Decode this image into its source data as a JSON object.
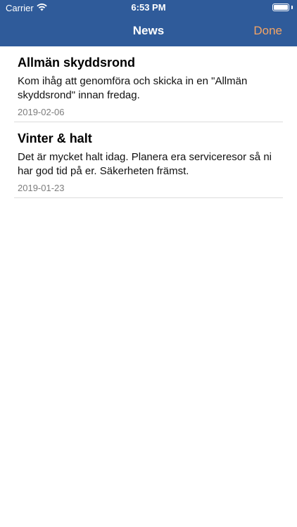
{
  "status_bar": {
    "carrier": "Carrier",
    "time": "6:53 PM",
    "wifi_icon": "wifi-icon",
    "battery_icon": "battery-icon"
  },
  "nav": {
    "title": "News",
    "done_label": "Done",
    "done_color": "#f3a465",
    "bar_color": "#2f5b9a"
  },
  "news": [
    {
      "title": "Allmän skyddsrond",
      "body": "Kom ihåg att genomföra och skicka in en \"Allmän skyddsrond\" innan fredag.",
      "date": "2019-02-06"
    },
    {
      "title": "Vinter & halt",
      "body": "Det är mycket halt idag. Planera era serviceresor så ni har god tid på er. Säkerheten främst.",
      "date": "2019-01-23"
    }
  ]
}
